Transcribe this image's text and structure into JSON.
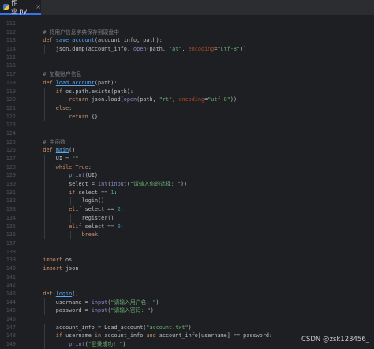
{
  "tab": {
    "label": "作业.py",
    "close": "×"
  },
  "watermark": "CSDN @zsk123456_",
  "colors": {
    "background": "#1e1f22",
    "tab_accent": "#3574f0",
    "keyword": "#cf8e6d",
    "function": "#56a8f5",
    "string": "#6aab73",
    "number": "#2aacb8",
    "comment": "#7a7e85",
    "builtin": "#8888c6",
    "param": "#aa4926",
    "text": "#bcbec4",
    "line_number": "#4b5059"
  },
  "lines": [
    {
      "n": "111",
      "indent": 0,
      "tokens": []
    },
    {
      "n": "112",
      "indent": 1,
      "tokens": [
        {
          "t": "# 将用户信息字典保存到硬盘中",
          "c": "cm"
        }
      ]
    },
    {
      "n": "113",
      "indent": 1,
      "tokens": [
        {
          "t": "def ",
          "c": "kw"
        },
        {
          "t": "save_account",
          "c": "fn"
        },
        {
          "t": "(account_info, path):",
          "c": "pl"
        }
      ]
    },
    {
      "n": "114",
      "indent": 2,
      "tokens": [
        {
          "t": "json.dump(account_info, ",
          "c": "pl"
        },
        {
          "t": "open",
          "c": "bi"
        },
        {
          "t": "(path, ",
          "c": "pl"
        },
        {
          "t": "\"at\"",
          "c": "str"
        },
        {
          "t": ", ",
          "c": "pl"
        },
        {
          "t": "encoding",
          "c": "param"
        },
        {
          "t": "=",
          "c": "pl"
        },
        {
          "t": "\"utf-8\"",
          "c": "str"
        },
        {
          "t": "))",
          "c": "pl"
        }
      ]
    },
    {
      "n": "115",
      "indent": 0,
      "tokens": []
    },
    {
      "n": "116",
      "indent": 0,
      "tokens": []
    },
    {
      "n": "117",
      "indent": 1,
      "tokens": [
        {
          "t": "# 加载账户信息",
          "c": "cm"
        }
      ]
    },
    {
      "n": "118",
      "indent": 1,
      "tokens": [
        {
          "t": "def ",
          "c": "kw"
        },
        {
          "t": "load_account",
          "c": "fn"
        },
        {
          "t": "(path):",
          "c": "pl"
        }
      ]
    },
    {
      "n": "119",
      "indent": 2,
      "tokens": [
        {
          "t": "if ",
          "c": "kw"
        },
        {
          "t": "os.path.exists(path):",
          "c": "pl"
        }
      ]
    },
    {
      "n": "120",
      "indent": 3,
      "tokens": [
        {
          "t": "return ",
          "c": "kw"
        },
        {
          "t": "json.load(",
          "c": "pl"
        },
        {
          "t": "open",
          "c": "bi"
        },
        {
          "t": "(path, ",
          "c": "pl"
        },
        {
          "t": "\"rt\"",
          "c": "str"
        },
        {
          "t": ", ",
          "c": "pl"
        },
        {
          "t": "encoding",
          "c": "param"
        },
        {
          "t": "=",
          "c": "pl"
        },
        {
          "t": "\"utf-8\"",
          "c": "str"
        },
        {
          "t": "))",
          "c": "pl"
        }
      ]
    },
    {
      "n": "121",
      "indent": 2,
      "tokens": [
        {
          "t": "else",
          "c": "kw"
        },
        {
          "t": ":",
          "c": "pl"
        }
      ]
    },
    {
      "n": "122",
      "indent": 3,
      "tokens": [
        {
          "t": "return ",
          "c": "kw"
        },
        {
          "t": "{}",
          "c": "pl"
        }
      ]
    },
    {
      "n": "123",
      "indent": 0,
      "tokens": []
    },
    {
      "n": "124",
      "indent": 0,
      "tokens": []
    },
    {
      "n": "125",
      "indent": 1,
      "tokens": [
        {
          "t": "# 主函数",
          "c": "cm"
        }
      ]
    },
    {
      "n": "126",
      "indent": 1,
      "tokens": [
        {
          "t": "def ",
          "c": "kw"
        },
        {
          "t": "main",
          "c": "fn"
        },
        {
          "t": "():",
          "c": "pl"
        }
      ]
    },
    {
      "n": "127",
      "indent": 2,
      "tokens": [
        {
          "t": "UI",
          "c": "pl"
        },
        {
          "t": " = ",
          "c": "pl"
        },
        {
          "t": "\"\"",
          "c": "str"
        }
      ]
    },
    {
      "n": "128",
      "indent": 2,
      "tokens": [
        {
          "t": "while ",
          "c": "kw"
        },
        {
          "t": "True",
          "c": "kw"
        },
        {
          "t": ":",
          "c": "pl"
        }
      ]
    },
    {
      "n": "129",
      "indent": 3,
      "tokens": [
        {
          "t": "print",
          "c": "bi"
        },
        {
          "t": "(UI)",
          "c": "pl"
        }
      ]
    },
    {
      "n": "130",
      "indent": 3,
      "tokens": [
        {
          "t": "select",
          "c": "pl"
        },
        {
          "t": " = ",
          "c": "pl"
        },
        {
          "t": "int",
          "c": "bi"
        },
        {
          "t": "(",
          "c": "pl"
        },
        {
          "t": "input",
          "c": "bi"
        },
        {
          "t": "(",
          "c": "pl"
        },
        {
          "t": "\"请输入你的选择: \"",
          "c": "str"
        },
        {
          "t": "))",
          "c": "pl"
        }
      ]
    },
    {
      "n": "131",
      "indent": 3,
      "tokens": [
        {
          "t": "if ",
          "c": "kw"
        },
        {
          "t": "select == ",
          "c": "pl"
        },
        {
          "t": "1",
          "c": "num"
        },
        {
          "t": ":",
          "c": "pl"
        }
      ]
    },
    {
      "n": "132",
      "indent": 4,
      "tokens": [
        {
          "t": "login()",
          "c": "pl"
        }
      ]
    },
    {
      "n": "133",
      "indent": 3,
      "tokens": [
        {
          "t": "elif ",
          "c": "kw"
        },
        {
          "t": "select == ",
          "c": "pl"
        },
        {
          "t": "2",
          "c": "num"
        },
        {
          "t": ":",
          "c": "pl"
        }
      ]
    },
    {
      "n": "134",
      "indent": 4,
      "tokens": [
        {
          "t": "register()",
          "c": "pl"
        }
      ]
    },
    {
      "n": "135",
      "indent": 3,
      "tokens": [
        {
          "t": "elif ",
          "c": "kw"
        },
        {
          "t": "select == ",
          "c": "pl"
        },
        {
          "t": "0",
          "c": "num"
        },
        {
          "t": ":",
          "c": "pl"
        }
      ]
    },
    {
      "n": "136",
      "indent": 4,
      "tokens": [
        {
          "t": "break",
          "c": "kw"
        }
      ]
    },
    {
      "n": "137",
      "indent": 0,
      "tokens": []
    },
    {
      "n": "138",
      "indent": 0,
      "tokens": []
    },
    {
      "n": "139",
      "indent": 1,
      "tokens": [
        {
          "t": "import ",
          "c": "kw"
        },
        {
          "t": "os",
          "c": "pl"
        }
      ]
    },
    {
      "n": "140",
      "indent": 1,
      "tokens": [
        {
          "t": "import ",
          "c": "kw"
        },
        {
          "t": "json",
          "c": "pl"
        }
      ]
    },
    {
      "n": "141",
      "indent": 0,
      "tokens": []
    },
    {
      "n": "142",
      "indent": 0,
      "tokens": []
    },
    {
      "n": "143",
      "indent": 1,
      "tokens": [
        {
          "t": "def ",
          "c": "kw"
        },
        {
          "t": "login",
          "c": "fn"
        },
        {
          "t": "():",
          "c": "pl"
        }
      ]
    },
    {
      "n": "144",
      "indent": 2,
      "tokens": [
        {
          "t": "username = ",
          "c": "pl"
        },
        {
          "t": "input",
          "c": "bi"
        },
        {
          "t": "(",
          "c": "pl"
        },
        {
          "t": "\"请输入用户名: \"",
          "c": "str"
        },
        {
          "t": ")",
          "c": "pl"
        }
      ]
    },
    {
      "n": "145",
      "indent": 2,
      "tokens": [
        {
          "t": "password = ",
          "c": "pl"
        },
        {
          "t": "input",
          "c": "bi"
        },
        {
          "t": "(",
          "c": "pl"
        },
        {
          "t": "\"请输入密码: \"",
          "c": "str"
        },
        {
          "t": ")",
          "c": "pl"
        }
      ]
    },
    {
      "n": "146",
      "indent": 0,
      "tokens": []
    },
    {
      "n": "147",
      "indent": 2,
      "tokens": [
        {
          "t": "account_info = Load_account(",
          "c": "pl"
        },
        {
          "t": "\"account.txt\"",
          "c": "str"
        },
        {
          "t": ")",
          "c": "pl"
        }
      ]
    },
    {
      "n": "148",
      "indent": 2,
      "tokens": [
        {
          "t": "if ",
          "c": "kw"
        },
        {
          "t": "username ",
          "c": "pl"
        },
        {
          "t": "in ",
          "c": "kw"
        },
        {
          "t": "account_info ",
          "c": "pl"
        },
        {
          "t": "and ",
          "c": "kw"
        },
        {
          "t": "account_info[username] == password:",
          "c": "pl"
        }
      ]
    },
    {
      "n": "149",
      "indent": 3,
      "tokens": [
        {
          "t": "print",
          "c": "bi"
        },
        {
          "t": "(",
          "c": "pl"
        },
        {
          "t": "\"登录成功! \"",
          "c": "str"
        },
        {
          "t": ")",
          "c": "pl"
        }
      ]
    }
  ]
}
